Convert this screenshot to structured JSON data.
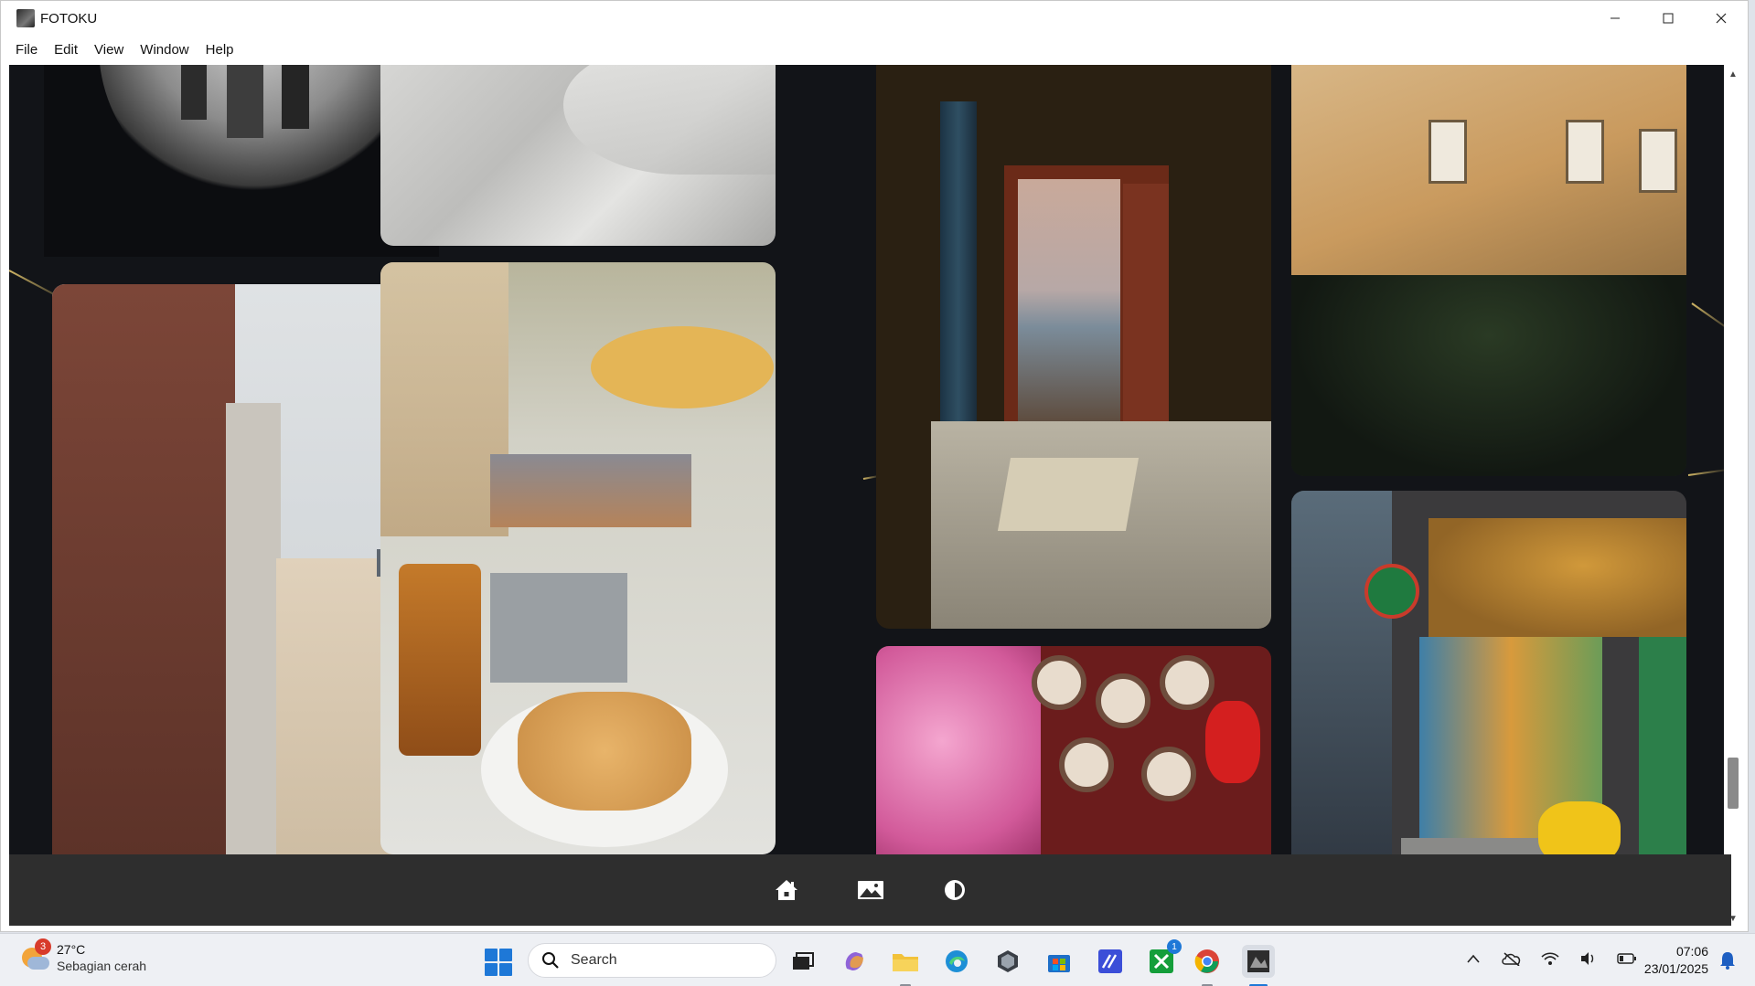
{
  "window": {
    "title": "FOTOKU",
    "controls": [
      "—",
      "☐",
      "✕"
    ]
  },
  "menu": {
    "items": [
      {
        "label": "File"
      },
      {
        "label": "Edit"
      },
      {
        "label": "View"
      },
      {
        "label": "Window"
      },
      {
        "label": "Help"
      }
    ]
  },
  "gallery": {
    "photos": [
      {
        "name": "photo-fisheye-city",
        "icon": "image"
      },
      {
        "name": "photo-bed-linen",
        "icon": "image"
      },
      {
        "name": "photo-balcony-room",
        "icon": "image"
      },
      {
        "name": "photo-building-tree-shadow",
        "icon": "image"
      },
      {
        "name": "photo-paris-buildings",
        "icon": "image"
      },
      {
        "name": "photo-food-table",
        "icon": "image"
      },
      {
        "name": "photo-red-fans-blossoms",
        "icon": "image"
      },
      {
        "name": "photo-colorful-alley",
        "icon": "image"
      }
    ]
  },
  "bottom_nav": {
    "items": [
      {
        "name": "home-icon"
      },
      {
        "name": "gallery-icon"
      },
      {
        "name": "theme-toggle-icon"
      }
    ]
  },
  "taskbar": {
    "weather": {
      "temp": "27°C",
      "desc": "Sebagian cerah",
      "badge": "3"
    },
    "search_label": "Search",
    "xbox_badge": "1",
    "clock": {
      "time": "07:06",
      "date": "23/01/2025"
    }
  },
  "colors": {
    "accent": "#1e78d7",
    "gallery_bg": "#121418",
    "bottom_bar": "#2e2e2e",
    "gold_line": "#e6c86e"
  }
}
